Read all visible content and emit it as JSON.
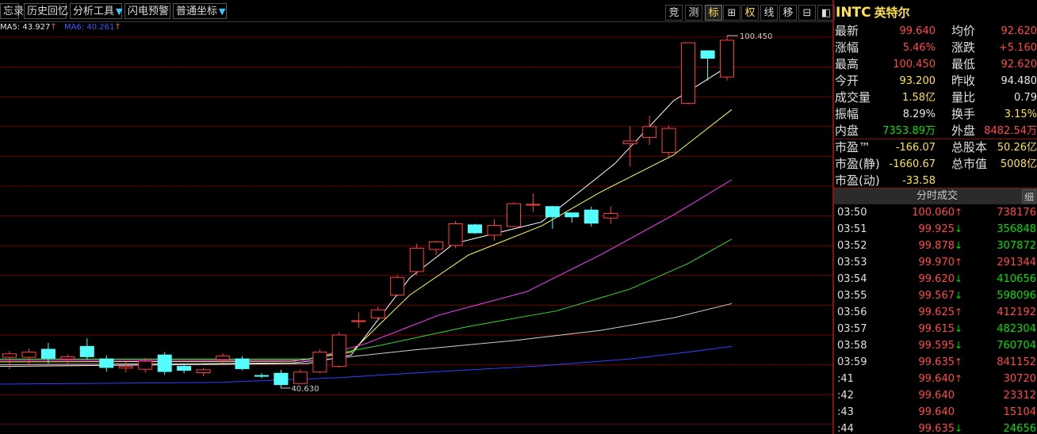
{
  "toolbar": {
    "buttons": [
      {
        "label": "忘录",
        "dropdown": false
      },
      {
        "label": "历史回忆",
        "dropdown": false
      },
      {
        "label": "分析工具",
        "dropdown": true
      },
      {
        "label": "闪电预警",
        "dropdown": false
      },
      {
        "label": "普通坐标",
        "dropdown": true
      }
    ],
    "dropdown_glyph": "▼",
    "right_buttons": [
      "竞",
      "测",
      "标",
      "⊞",
      "权",
      "线",
      "移",
      "⊟",
      "◧"
    ]
  },
  "ma_legend": {
    "ma5_text": "MA5: 43.927",
    "ma6_text": "MA6: 40.261",
    "arrow": "↑"
  },
  "chart_data": {
    "type": "candlestick",
    "high_label": "100.450",
    "low_label": "40.630",
    "candles": [
      {
        "o": 44.1,
        "h": 45.2,
        "l": 42.0,
        "c": 44.7
      },
      {
        "o": 44.1,
        "h": 45.6,
        "l": 42.7,
        "c": 45.0
      },
      {
        "o": 45.5,
        "h": 46.6,
        "l": 43.0,
        "c": 43.9
      },
      {
        "o": 43.8,
        "h": 44.6,
        "l": 43.0,
        "c": 44.2
      },
      {
        "o": 46.0,
        "h": 47.4,
        "l": 43.7,
        "c": 44.2
      },
      {
        "o": 43.8,
        "h": 44.4,
        "l": 41.6,
        "c": 42.3
      },
      {
        "o": 42.2,
        "h": 43.3,
        "l": 41.4,
        "c": 42.5
      },
      {
        "o": 42.0,
        "h": 44.0,
        "l": 41.4,
        "c": 43.4
      },
      {
        "o": 44.5,
        "h": 45.0,
        "l": 41.0,
        "c": 41.6
      },
      {
        "o": 42.5,
        "h": 42.9,
        "l": 41.3,
        "c": 41.8
      },
      {
        "o": 41.4,
        "h": 42.2,
        "l": 40.8,
        "c": 41.9
      },
      {
        "o": 43.7,
        "h": 44.8,
        "l": 43.0,
        "c": 44.3
      },
      {
        "o": 43.8,
        "h": 44.3,
        "l": 41.8,
        "c": 42.1
      },
      {
        "o": 40.9,
        "h": 41.3,
        "l": 40.4,
        "c": 40.8
      },
      {
        "o": 41.3,
        "h": 41.9,
        "l": 38.7,
        "c": 39.3
      },
      {
        "o": 39.5,
        "h": 42.0,
        "l": 39.5,
        "c": 41.5
      },
      {
        "o": 41.5,
        "h": 45.5,
        "l": 41.3,
        "c": 45.0
      },
      {
        "o": 42.5,
        "h": 48.5,
        "l": 42.3,
        "c": 48.0
      },
      {
        "o": 50.5,
        "h": 52.0,
        "l": 49.2,
        "c": 50.5
      },
      {
        "o": 51.0,
        "h": 53.0,
        "l": 50.5,
        "c": 52.4
      },
      {
        "o": 55.0,
        "h": 58.5,
        "l": 54.8,
        "c": 58.1
      },
      {
        "o": 59.1,
        "h": 64.0,
        "l": 58.5,
        "c": 63.2
      },
      {
        "o": 63.0,
        "h": 64.5,
        "l": 62.0,
        "c": 64.3
      },
      {
        "o": 63.7,
        "h": 68.0,
        "l": 63.2,
        "c": 67.5
      },
      {
        "o": 67.3,
        "h": 67.5,
        "l": 65.7,
        "c": 65.9
      },
      {
        "o": 65.5,
        "h": 68.3,
        "l": 64.5,
        "c": 67.2
      },
      {
        "o": 67.0,
        "h": 71.3,
        "l": 66.9,
        "c": 71.0
      },
      {
        "o": 70.8,
        "h": 72.8,
        "l": 69.6,
        "c": 70.9
      },
      {
        "o": 70.5,
        "h": 70.6,
        "l": 66.6,
        "c": 68.7
      },
      {
        "o": 69.4,
        "h": 69.4,
        "l": 67.7,
        "c": 68.7
      },
      {
        "o": 69.9,
        "h": 70.5,
        "l": 67.0,
        "c": 67.6
      },
      {
        "o": 68.5,
        "h": 70.5,
        "l": 67.5,
        "c": 69.3
      },
      {
        "o": 81.5,
        "h": 84.5,
        "l": 77.5,
        "c": 82.0
      },
      {
        "o": 82.6,
        "h": 86.4,
        "l": 81.3,
        "c": 84.5
      },
      {
        "o": 80.0,
        "h": 84.7,
        "l": 79.3,
        "c": 84.2
      },
      {
        "o": 88.6,
        "h": 99.2,
        "l": 88.4,
        "c": 99.2
      },
      {
        "o": 97.8,
        "h": 97.8,
        "l": 92.6,
        "c": 96.5
      },
      {
        "o": 93.2,
        "h": 100.45,
        "l": 92.6,
        "c": 99.64
      }
    ],
    "ma_lines": [
      {
        "color": "#ffffff",
        "points": [
          [
            0,
            42.5
          ],
          [
            0.42,
            43.0
          ],
          [
            0.48,
            44.5
          ],
          [
            0.56,
            58
          ],
          [
            0.62,
            64
          ],
          [
            0.74,
            67.8
          ],
          [
            0.84,
            78
          ],
          [
            0.92,
            89
          ],
          [
            1.0,
            95.5
          ]
        ]
      },
      {
        "color": "#ffff50",
        "points": [
          [
            0,
            43.3
          ],
          [
            0.4,
            43.4
          ],
          [
            0.48,
            45.0
          ],
          [
            0.56,
            55
          ],
          [
            0.64,
            62
          ],
          [
            0.74,
            67.1
          ],
          [
            0.82,
            73
          ],
          [
            0.92,
            79.5
          ],
          [
            1.0,
            87.5
          ]
        ]
      },
      {
        "color": "#ff40ff",
        "points": [
          [
            0,
            43.6
          ],
          [
            0.42,
            43.6
          ],
          [
            0.5,
            46.5
          ],
          [
            0.6,
            51.5
          ],
          [
            0.72,
            55.6
          ],
          [
            0.82,
            62
          ],
          [
            0.92,
            69
          ],
          [
            1.0,
            75.2
          ]
        ]
      },
      {
        "color": "#30dd30",
        "points": [
          [
            0,
            43.8
          ],
          [
            0.42,
            43.8
          ],
          [
            0.52,
            46.2
          ],
          [
            0.64,
            49.5
          ],
          [
            0.76,
            52.2
          ],
          [
            0.86,
            56
          ],
          [
            0.94,
            60.5
          ],
          [
            1.0,
            64.8
          ]
        ]
      },
      {
        "color": "#d0d0d0",
        "points": [
          [
            0,
            42.8
          ],
          [
            0.4,
            43.1
          ],
          [
            0.56,
            45.3
          ],
          [
            0.7,
            47.0
          ],
          [
            0.82,
            48.8
          ],
          [
            0.92,
            51.0
          ],
          [
            1.0,
            53.5
          ]
        ]
      },
      {
        "color": "#3040ff",
        "points": [
          [
            0,
            39.4
          ],
          [
            0.3,
            39.7
          ],
          [
            0.46,
            40.5
          ],
          [
            0.6,
            41.6
          ],
          [
            0.74,
            42.6
          ],
          [
            0.86,
            43.8
          ],
          [
            0.94,
            45.0
          ],
          [
            1.0,
            46.0
          ]
        ]
      }
    ],
    "colors": {
      "up": "#ff3f3f",
      "down": "#54fcfc"
    }
  },
  "quote": {
    "symbol": "INTC",
    "name": "英特尔",
    "rows": [
      {
        "l": "最新",
        "v": "99.640",
        "vc": "red",
        "l2": "均价",
        "v2": "92.620",
        "v2c": "red"
      },
      {
        "l": "涨幅",
        "v": "5.46%",
        "vc": "red",
        "l2": "涨跌",
        "v2": "+5.160",
        "v2c": "red"
      },
      {
        "l": "最高",
        "v": "100.450",
        "vc": "red",
        "l2": "最低",
        "v2": "92.620",
        "v2c": "red"
      },
      {
        "l": "今开",
        "v": "93.200",
        "vc": "yellow",
        "l2": "昨收",
        "v2": "94.480",
        "v2c": "white"
      },
      {
        "l": "成交量",
        "v": "1.58亿",
        "vc": "yellow",
        "l2": "量比",
        "v2": "0.79",
        "v2c": "white"
      },
      {
        "l": "振幅",
        "v": "8.29%",
        "vc": "white",
        "l2": "换手",
        "v2": "3.15%",
        "v2c": "yellow"
      },
      {
        "l": "内盘",
        "v": "7353.89万",
        "vc": "green",
        "l2": "外盘",
        "v2": "8482.54万",
        "v2c": "red"
      }
    ],
    "rows2": [
      {
        "l": "市盈™",
        "v": "-166.07",
        "vc": "yellow",
        "l2": "总股本",
        "v2": "50.26亿",
        "v2c": "yellow"
      },
      {
        "l": "市盈(静)",
        "v": "-1660.67",
        "vc": "yellow",
        "l2": "总市值",
        "v2": "5008亿",
        "v2c": "yellow"
      },
      {
        "l": "市盈(动)",
        "v": "-33.58",
        "vc": "yellow",
        "l2": "",
        "v2": "",
        "v2c": "yellow"
      }
    ]
  },
  "ticks": {
    "header": "分时成交",
    "detail_button": "细",
    "rows": [
      {
        "t": "03:50",
        "p": "100.060",
        "d": "up",
        "v": "738176"
      },
      {
        "t": "03:51",
        "p": "99.925",
        "d": "down",
        "v": "356848"
      },
      {
        "t": "03:52",
        "p": "99.878",
        "d": "down",
        "v": "307872"
      },
      {
        "t": "03:53",
        "p": "99.970",
        "d": "up",
        "v": "291344"
      },
      {
        "t": "03:54",
        "p": "99.620",
        "d": "down",
        "v": "410656"
      },
      {
        "t": "03:55",
        "p": "99.567",
        "d": "down",
        "v": "598096"
      },
      {
        "t": "03:56",
        "p": "99.625",
        "d": "up",
        "v": "412192"
      },
      {
        "t": "03:57",
        "p": "99.615",
        "d": "down",
        "v": "482304"
      },
      {
        "t": "03:58",
        "p": "99.595",
        "d": "down",
        "v": "760704"
      },
      {
        "t": "03:59",
        "p": "99.635",
        "d": "up",
        "v": "841152"
      },
      {
        "t": ":41",
        "p": "99.640",
        "d": "up",
        "v": "30720"
      },
      {
        "t": ":42",
        "p": "99.640",
        "d": "",
        "v": "23312"
      },
      {
        "t": ":43",
        "p": "99.640",
        "d": "",
        "v": "15104"
      },
      {
        "t": ":44",
        "p": "99.635",
        "d": "down",
        "v": "24656"
      }
    ]
  }
}
